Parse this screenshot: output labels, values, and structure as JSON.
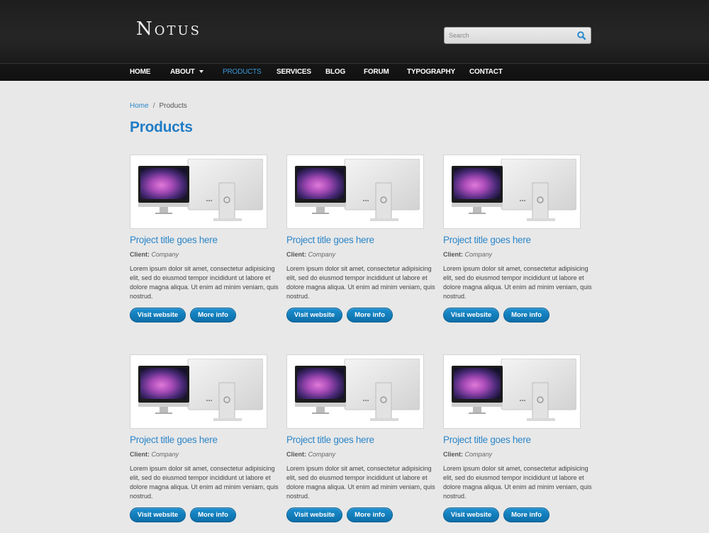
{
  "header": {
    "logo": "Notus",
    "search": {
      "placeholder": "Search"
    }
  },
  "nav": {
    "items": [
      {
        "label": "HOME",
        "active": false
      },
      {
        "label": "ABOUT",
        "active": false,
        "dropdown": true
      },
      {
        "label": "PRODUCTS",
        "active": true
      },
      {
        "label": "SERVICES",
        "active": false
      },
      {
        "label": "BLOG",
        "active": false
      },
      {
        "label": "FORUM",
        "active": false
      },
      {
        "label": "TYPOGRAPHY",
        "active": false
      },
      {
        "label": "CONTACT",
        "active": false
      }
    ]
  },
  "breadcrumb": {
    "home": "Home",
    "separator": "/",
    "current": "Products"
  },
  "page_title": "Products",
  "projects": [
    {
      "title": "Project title goes here",
      "client_label": "Client:",
      "client": "Company",
      "description": "Lorem ipsum dolor sit amet, consectetur adipisicing elit, sed do eiusmod tempor incididunt ut labore et dolore magna aliqua. Ut enim ad minim veniam, quis nostrud.",
      "visit_label": "Visit website",
      "more_label": "More info"
    },
    {
      "title": "Project title goes here",
      "client_label": "Client:",
      "client": "Company",
      "description": "Lorem ipsum dolor sit amet, consectetur adipisicing elit, sed do eiusmod tempor incididunt ut labore et dolore magna aliqua. Ut enim ad minim veniam, quis nostrud.",
      "visit_label": "Visit website",
      "more_label": "More info"
    },
    {
      "title": "Project title goes here",
      "client_label": "Client:",
      "client": "Company",
      "description": "Lorem ipsum dolor sit amet, consectetur adipisicing elit, sed do eiusmod tempor incididunt ut labore et dolore magna aliqua. Ut enim ad minim veniam, quis nostrud.",
      "visit_label": "Visit website",
      "more_label": "More info"
    },
    {
      "title": "Project title goes here",
      "client_label": "Client:",
      "client": "Company",
      "description": "Lorem ipsum dolor sit amet, consectetur adipisicing elit, sed do eiusmod tempor incididunt ut labore et dolore magna aliqua. Ut enim ad minim veniam, quis nostrud.",
      "visit_label": "Visit website",
      "more_label": "More info"
    },
    {
      "title": "Project title goes here",
      "client_label": "Client:",
      "client": "Company",
      "description": "Lorem ipsum dolor sit amet, consectetur adipisicing elit, sed do eiusmod tempor incididunt ut labore et dolore magna aliqua. Ut enim ad minim veniam, quis nostrud.",
      "visit_label": "Visit website",
      "more_label": "More info"
    },
    {
      "title": "Project title goes here",
      "client_label": "Client:",
      "client": "Company",
      "description": "Lorem ipsum dolor sit amet, consectetur adipisicing elit, sed do eiusmod tempor incididunt ut labore et dolore magna aliqua. Ut enim ad minim veniam, quis nostrud.",
      "visit_label": "Visit website",
      "more_label": "More info"
    }
  ],
  "colors": {
    "accent": "#2d86c9",
    "button": "#137fbd",
    "header_bg": "#222222",
    "page_bg": "#e8e8e8"
  },
  "icons": {
    "search": "search-icon",
    "dropdown": "caret-down-icon",
    "thumbnail": "computer-monitors-image"
  }
}
